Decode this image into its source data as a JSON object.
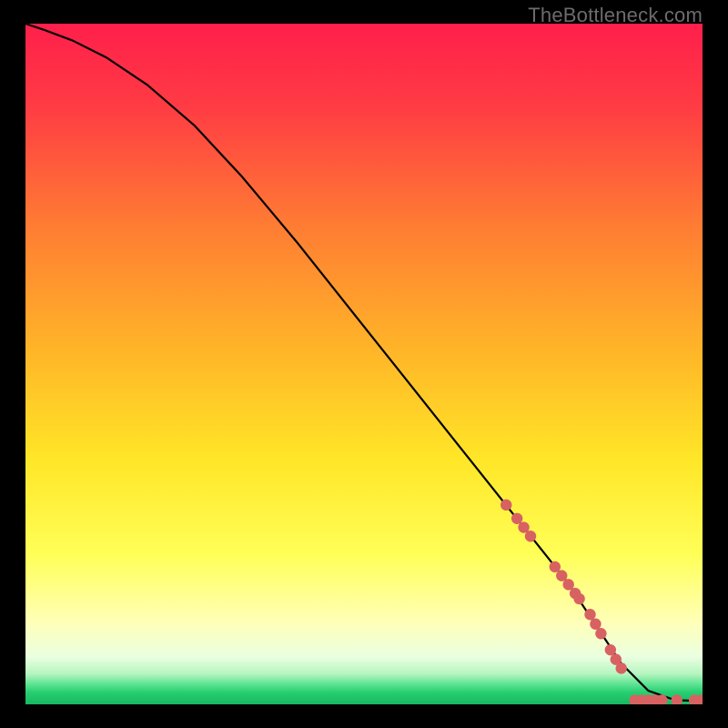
{
  "watermark": "TheBottleneck.com",
  "colors": {
    "bg_black": "#000000",
    "gradient_top": "#ff1f4b",
    "gradient_mid1": "#ff8a2b",
    "gradient_mid2": "#ffe627",
    "gradient_pale": "#ffffb0",
    "gradient_green": "#2dd47b",
    "curve": "#000000",
    "marker": "#d86262"
  },
  "chart_data": {
    "type": "line",
    "title": "",
    "xlabel": "",
    "ylabel": "",
    "xlim": [
      0,
      100
    ],
    "ylim": [
      0,
      100
    ],
    "series": [
      {
        "name": "bottleneck-curve",
        "x": [
          0,
          3,
          7,
          12,
          18,
          25,
          32,
          40,
          48,
          56,
          64,
          72,
          80,
          84,
          88,
          92,
          96,
          100
        ],
        "y": [
          100,
          99,
          97.5,
          95,
          91,
          85,
          77.5,
          68,
          58,
          48,
          38,
          28,
          18,
          12,
          6,
          2,
          0.6,
          0.5
        ]
      }
    ],
    "markers": [
      {
        "x": 71.0,
        "y": 29.3
      },
      {
        "x": 72.6,
        "y": 27.3
      },
      {
        "x": 73.6,
        "y": 26.0
      },
      {
        "x": 74.6,
        "y": 24.7
      },
      {
        "x": 78.2,
        "y": 20.2
      },
      {
        "x": 79.2,
        "y": 18.9
      },
      {
        "x": 80.2,
        "y": 17.6
      },
      {
        "x": 81.2,
        "y": 16.3
      },
      {
        "x": 81.8,
        "y": 15.5
      },
      {
        "x": 83.4,
        "y": 13.2
      },
      {
        "x": 84.2,
        "y": 11.8
      },
      {
        "x": 85.0,
        "y": 10.4
      },
      {
        "x": 86.4,
        "y": 8.0
      },
      {
        "x": 87.2,
        "y": 6.6
      },
      {
        "x": 88.0,
        "y": 5.3
      },
      {
        "x": 90.0,
        "y": 0.6
      },
      {
        "x": 91.0,
        "y": 0.6
      },
      {
        "x": 92.0,
        "y": 0.6
      },
      {
        "x": 93.0,
        "y": 0.6
      },
      {
        "x": 94.0,
        "y": 0.6
      },
      {
        "x": 96.2,
        "y": 0.6
      },
      {
        "x": 98.8,
        "y": 0.6
      },
      {
        "x": 99.8,
        "y": 0.6
      }
    ]
  }
}
